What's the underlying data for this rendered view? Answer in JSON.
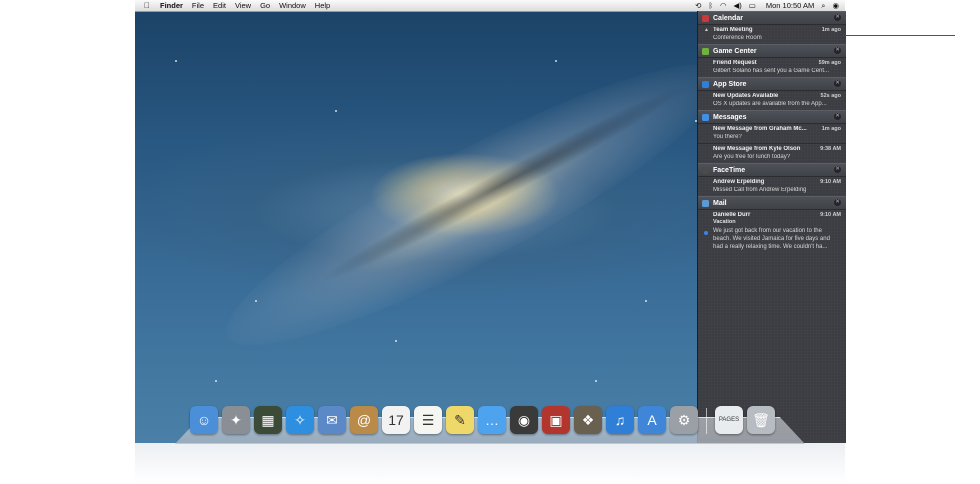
{
  "menubar": {
    "apple_icon": "apple-icon",
    "items": [
      "Finder",
      "File",
      "Edit",
      "View",
      "Go",
      "Window",
      "Help"
    ],
    "clock": "Mon 10:50 AM",
    "status_icons": [
      "time-machine-icon",
      "bluetooth-icon",
      "wifi-icon",
      "volume-icon",
      "battery-icon",
      "spotlight-icon",
      "notification-center-icon"
    ]
  },
  "notification_center": {
    "groups": [
      {
        "app": "Calendar",
        "icon_color": "#c9383a",
        "items": [
          {
            "title": "Team Meeting",
            "time": "1m ago",
            "body": "Conference Room"
          }
        ]
      },
      {
        "app": "Game Center",
        "icon_color": "#6fb33e",
        "items": [
          {
            "title": "Friend Request",
            "time": "59m ago",
            "body": "Gilbert Solano has sent you a Game Cent..."
          }
        ]
      },
      {
        "app": "App Store",
        "icon_color": "#2f7fd6",
        "items": [
          {
            "title": "New Updates Available",
            "time": "52s ago",
            "body": "OS X updates are available from the App..."
          }
        ]
      },
      {
        "app": "Messages",
        "icon_color": "#3d8fe8",
        "items": [
          {
            "title": "New Message from Graham Mc...",
            "time": "1m ago",
            "body": "You there?"
          },
          {
            "title": "New Message from Kyle Olson",
            "time": "9:38 AM",
            "body": "Are you free for lunch today?"
          }
        ]
      },
      {
        "app": "FaceTime",
        "icon_color": "#4b4b4b",
        "items": [
          {
            "title": "Andrew Erpelding",
            "time": "9:10 AM",
            "body": "Missed Call from Andrew Erpelding"
          }
        ]
      },
      {
        "app": "Mail",
        "icon_color": "#5a9ad6",
        "items": [
          {
            "title": "Danielle Durr",
            "time": "9:10 AM",
            "subtitle": "Vacation",
            "body": "We just got back from our vacation to the beach.  We visited Jamaica for five days and had a really relaxing time.  We couldn't ha..."
          }
        ]
      }
    ]
  },
  "dock": {
    "apps": [
      {
        "name": "Finder",
        "icon": "finder-icon",
        "color": "#4b8fd8",
        "glyph": "☺"
      },
      {
        "name": "Launchpad",
        "icon": "launchpad-icon",
        "color": "#8a8f96",
        "glyph": "✦"
      },
      {
        "name": "Mission Control",
        "icon": "mission-control-icon",
        "color": "#3c4a38",
        "glyph": "▦"
      },
      {
        "name": "Safari",
        "icon": "safari-icon",
        "color": "#2e8fe0",
        "glyph": "✧"
      },
      {
        "name": "Mail",
        "icon": "mail-icon",
        "color": "#5b88c6",
        "glyph": "✉"
      },
      {
        "name": "Contacts",
        "icon": "contacts-icon",
        "color": "#b98a48",
        "glyph": "@"
      },
      {
        "name": "Calendar",
        "icon": "calendar-icon",
        "color": "#f2f2f2",
        "glyph": "17"
      },
      {
        "name": "Reminders",
        "icon": "reminders-icon",
        "color": "#f5f5f2",
        "glyph": "☰"
      },
      {
        "name": "Notes",
        "icon": "notes-icon",
        "color": "#efd86a",
        "glyph": "✎"
      },
      {
        "name": "Messages",
        "icon": "messages-icon",
        "color": "#4ea3ee",
        "glyph": "…"
      },
      {
        "name": "FaceTime",
        "icon": "facetime-icon",
        "color": "#3a3a3a",
        "glyph": "◉"
      },
      {
        "name": "Photo Booth",
        "icon": "photo-booth-icon",
        "color": "#b3362e",
        "glyph": "▣"
      },
      {
        "name": "iPhoto",
        "icon": "iphoto-icon",
        "color": "#6a6050",
        "glyph": "❖"
      },
      {
        "name": "iTunes",
        "icon": "itunes-icon",
        "color": "#2f7fd6",
        "glyph": "♫"
      },
      {
        "name": "App Store",
        "icon": "app-store-icon",
        "color": "#3f86d9",
        "glyph": "A"
      },
      {
        "name": "System Preferences",
        "icon": "system-preferences-icon",
        "color": "#9aa0a6",
        "glyph": "⚙"
      }
    ],
    "docs": [
      {
        "name": "Pages Document",
        "icon": "pages-document-icon",
        "color": "#e8ecef",
        "glyph": "PAGES"
      },
      {
        "name": "Trash",
        "icon": "trash-icon",
        "color": "#b7bcc2",
        "glyph": "🗑"
      }
    ]
  }
}
